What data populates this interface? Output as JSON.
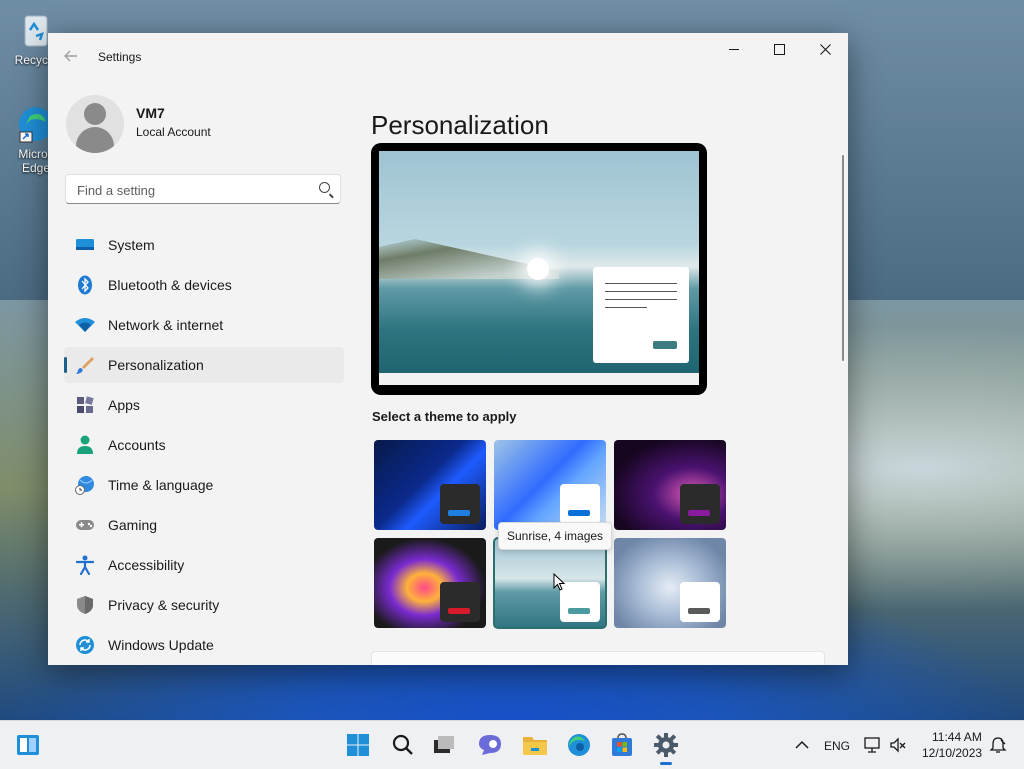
{
  "desktop": {
    "icons": [
      {
        "label": "Recycle"
      },
      {
        "label": "Micros Edge"
      }
    ]
  },
  "window": {
    "title": "Settings",
    "back_icon": "arrow-left-icon",
    "controls": [
      "minimize-icon",
      "maximize-icon",
      "close-icon"
    ]
  },
  "profile": {
    "name": "VM7",
    "account_type": "Local Account"
  },
  "search": {
    "placeholder": "Find a setting",
    "value": "",
    "icon": "search-icon"
  },
  "nav": {
    "items": [
      {
        "label": "System",
        "icon": "monitor-icon",
        "color": "#0078d4"
      },
      {
        "label": "Bluetooth & devices",
        "icon": "bluetooth-icon",
        "color": "#0078d4"
      },
      {
        "label": "Network & internet",
        "icon": "wifi-icon",
        "color": "#0078d4"
      },
      {
        "label": "Personalization",
        "icon": "paintbrush-icon",
        "color": "#e8832a",
        "active": true
      },
      {
        "label": "Apps",
        "icon": "apps-icon",
        "color": "#5a5a8a"
      },
      {
        "label": "Accounts",
        "icon": "person-icon",
        "color": "#1aa37a"
      },
      {
        "label": "Time & language",
        "icon": "globe-clock-icon",
        "color": "#1f7ad4"
      },
      {
        "label": "Gaming",
        "icon": "gamepad-icon",
        "color": "#7a7a7a"
      },
      {
        "label": "Accessibility",
        "icon": "accessibility-icon",
        "color": "#1f6fd0"
      },
      {
        "label": "Privacy & security",
        "icon": "shield-icon",
        "color": "#7a7a7a"
      },
      {
        "label": "Windows Update",
        "icon": "sync-icon",
        "color": "#0078d4"
      }
    ]
  },
  "main": {
    "title": "Personalization",
    "theme_section_label": "Select a theme to apply",
    "themes": [
      {
        "name": "theme-windows-dark",
        "bg": "linear-gradient(135deg,#071a4a 0%,#0b2a8c 45%,#1e5bff 60%,#0a1d5c 100%)",
        "pill": "#2b2b2b",
        "bar": "#1f7fe0"
      },
      {
        "name": "theme-windows-light",
        "bg": "linear-gradient(135deg,#9fc4e6 0%,#2f6cff 45%,#63a4ff 60%,#c9dff2 100%)",
        "pill": "#ffffff",
        "bar": "#0a6fd6"
      },
      {
        "name": "theme-glow",
        "bg": "radial-gradient(ellipse at 70% 60%,#e05ab8 0%,#4a1270 35%,#160620 75%)",
        "pill": "#2b2b2b",
        "bar": "#8a1aa0"
      },
      {
        "name": "theme-captured-motion",
        "bg": "radial-gradient(ellipse at 45% 55%,#ff4a8a 0%,#ffb23a 20%,#7a2bd0 40%,#1a1a1a 70%)",
        "pill": "#2b2b2b",
        "bar": "#d81b2c"
      },
      {
        "name": "theme-sunrise",
        "bg": "linear-gradient(180deg,#9fc3d3 0%,#d8e6e8 45%,#5f9aa6 60%,#2f7580 100%)",
        "pill": "#ffffff",
        "bar": "#4a9aa0",
        "selected": true
      },
      {
        "name": "theme-flow",
        "bg": "radial-gradient(ellipse at 50% 55%,#e6ecf5 0%,#a9bdd6 40%,#6f86a8 80%)",
        "pill": "#ffffff",
        "bar": "#5a5a5a"
      }
    ],
    "tooltip": "Sunrise, 4 images"
  },
  "taskbar": {
    "pinned": [
      {
        "name": "start-button",
        "icon": "windows-logo-icon"
      },
      {
        "name": "search-button",
        "icon": "search-icon"
      },
      {
        "name": "task-view-button",
        "icon": "task-view-icon"
      },
      {
        "name": "chat-button",
        "icon": "chat-icon"
      },
      {
        "name": "file-explorer-button",
        "icon": "folder-icon"
      },
      {
        "name": "edge-button",
        "icon": "edge-icon"
      },
      {
        "name": "store-button",
        "icon": "store-icon"
      },
      {
        "name": "settings-button",
        "icon": "gear-icon",
        "active": true
      }
    ],
    "language": "ENG",
    "time": "11:44 AM",
    "date": "12/10/2023"
  }
}
